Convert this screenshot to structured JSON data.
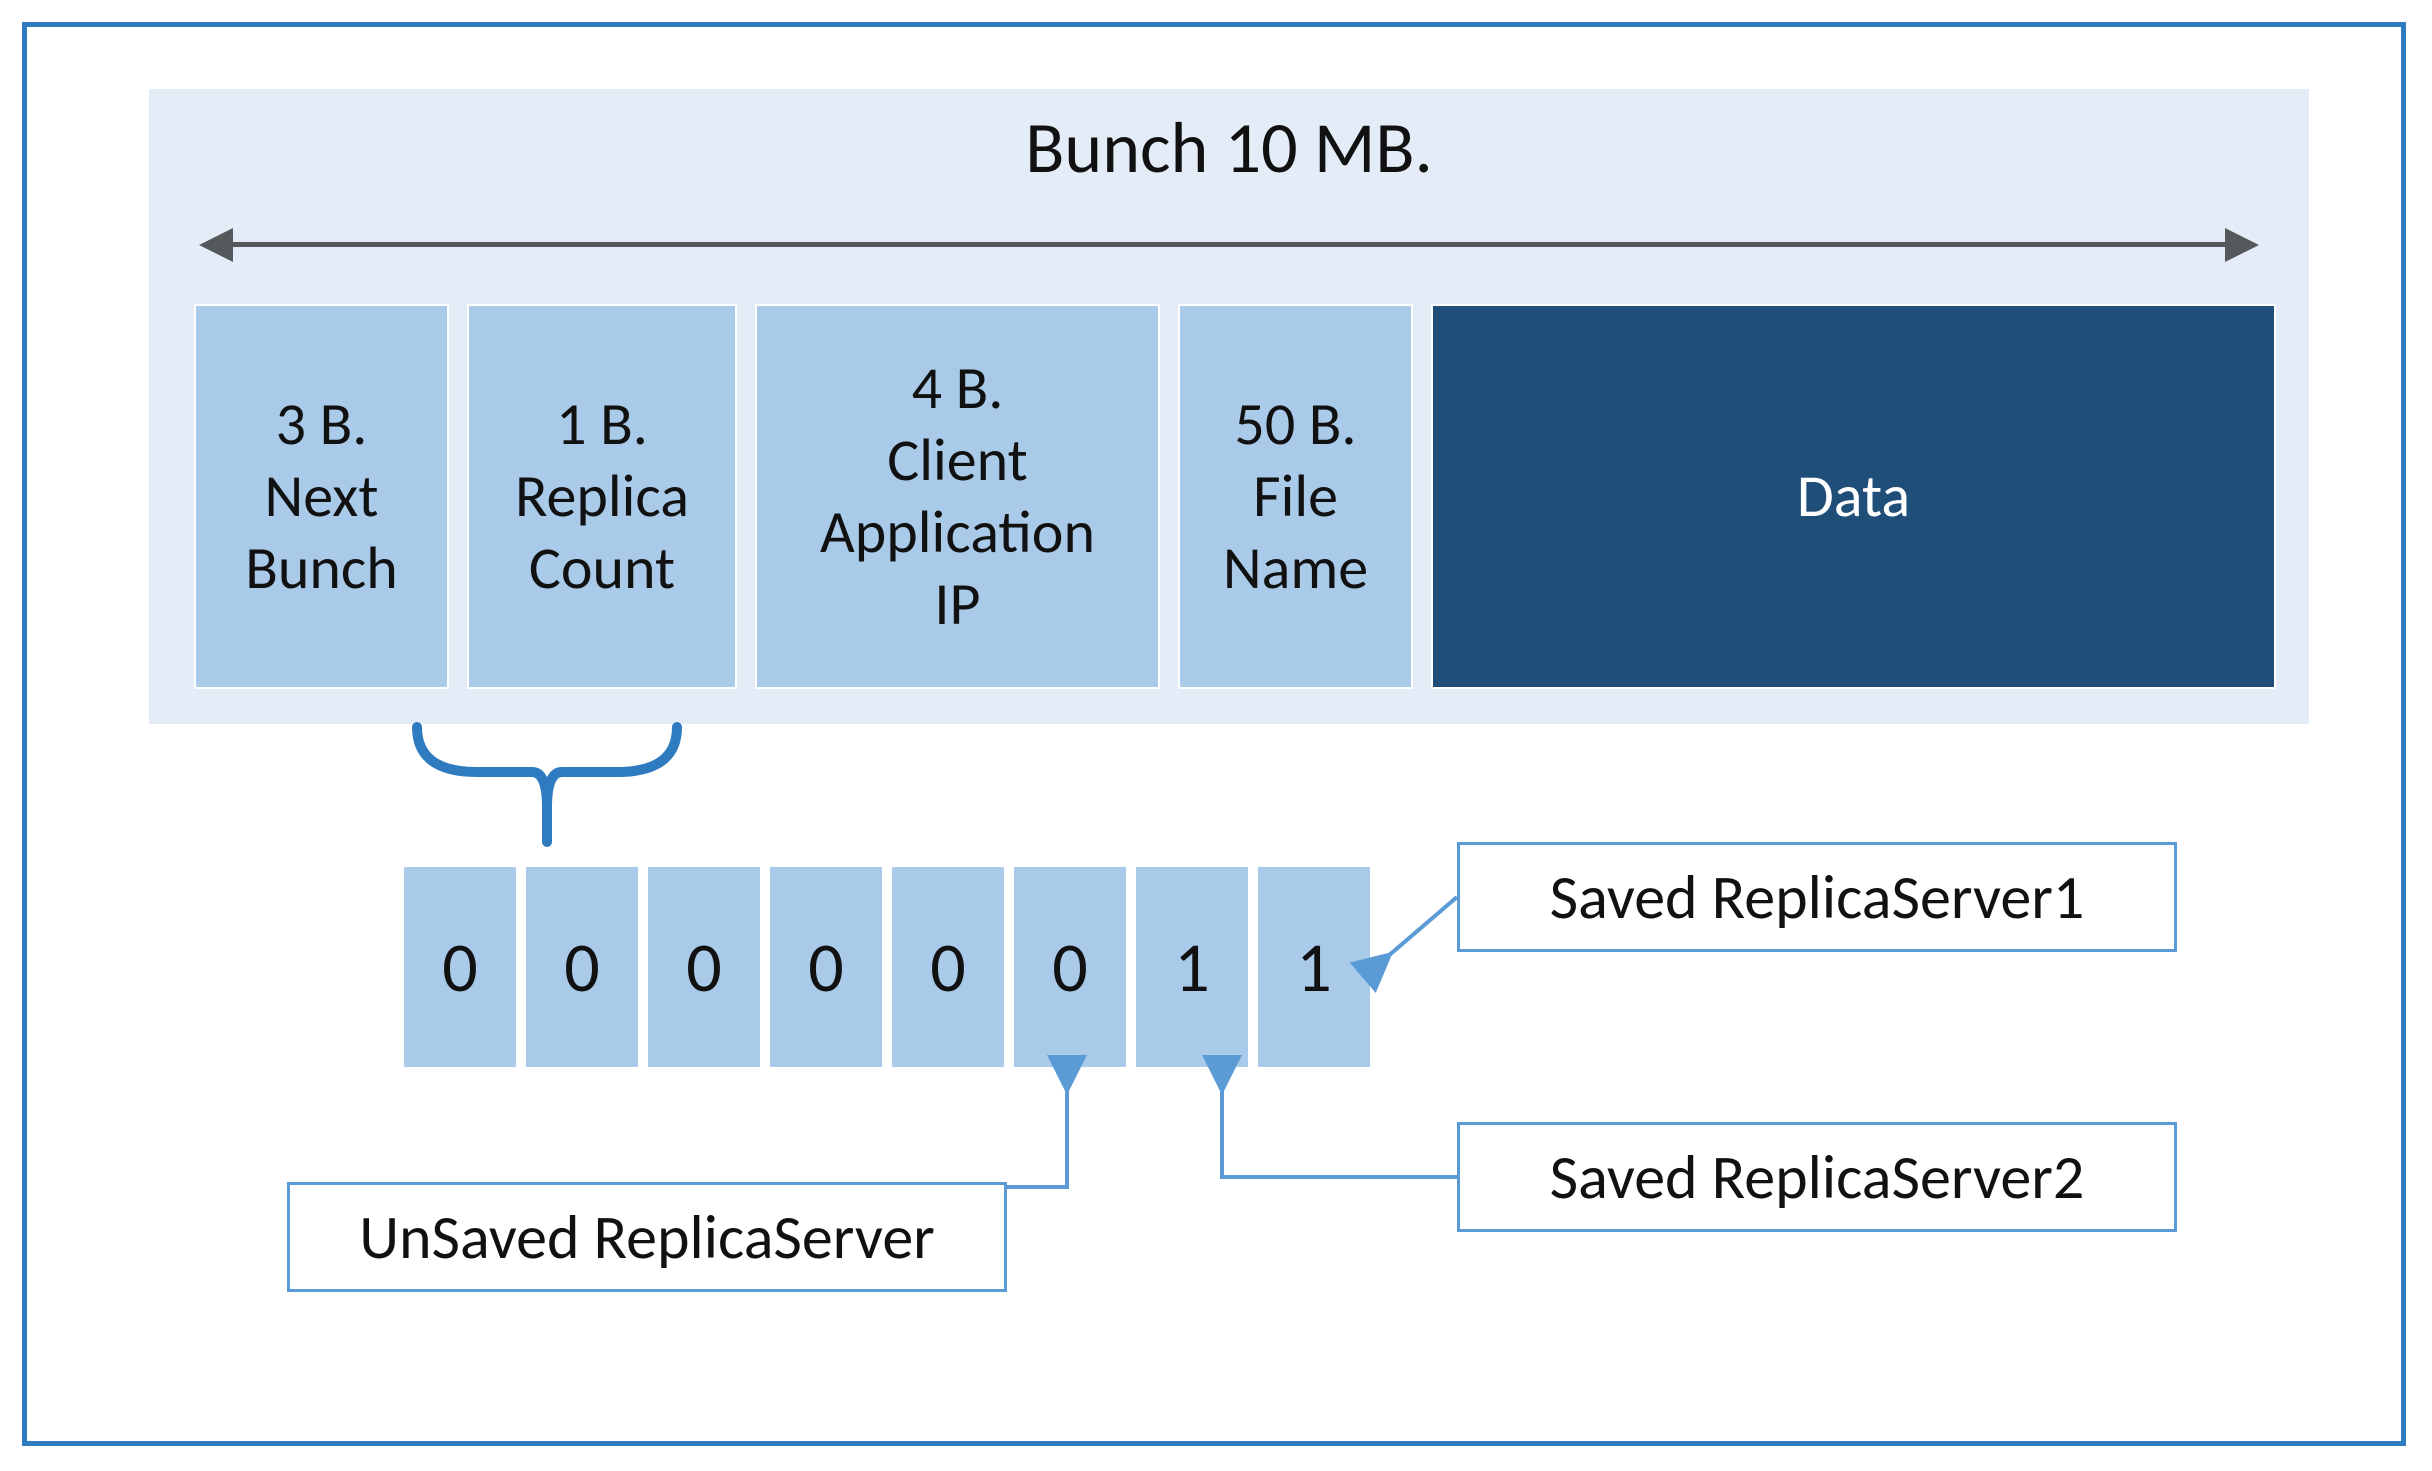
{
  "title": "Bunch 10 MB.",
  "fields": {
    "next_bunch": "3 B.\nNext\nBunch",
    "replica_count": "1 B.\nReplica\nCount",
    "client_ip": "4 B.\nClient\nApplication\nIP",
    "file_name": "50 B.\nFile\nName",
    "data": "Data"
  },
  "bits": [
    "0",
    "0",
    "0",
    "0",
    "0",
    "0",
    "1",
    "1"
  ],
  "labels": {
    "saved1": "Saved ReplicaServer1",
    "saved2": "Saved ReplicaServer2",
    "unsaved": "UnSaved ReplicaServer"
  },
  "colors": {
    "frame": "#2e7bc0",
    "panel": "#e4edf7",
    "field": "#a9cbe9",
    "field_dark": "#1f4e79",
    "accent": "#5b9bd5",
    "arrow": "#55595c"
  }
}
